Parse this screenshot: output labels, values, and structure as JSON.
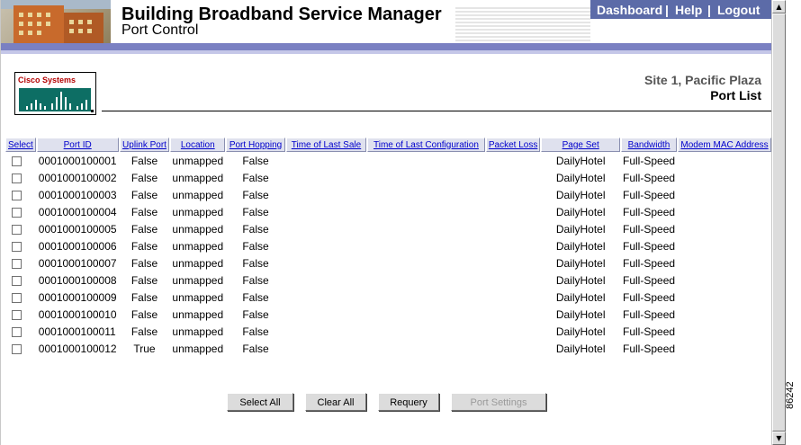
{
  "header": {
    "title": "Building Broadband Service Manager",
    "subtitle": "Port Control",
    "nav": {
      "dashboard": "Dashboard",
      "help": "Help",
      "logout": "Logout",
      "separator": "|"
    }
  },
  "logo": {
    "text": "Cisco Systems"
  },
  "site": {
    "name": "Site 1, Pacific Plaza",
    "page": "Port List"
  },
  "table": {
    "columns": [
      "Select",
      "Port ID",
      "Uplink Port",
      "Location",
      "Port Hopping",
      "Time of Last Sale",
      "Time of Last Configuration",
      "Packet Loss",
      "Page Set",
      "Bandwidth",
      "Modem MAC Address"
    ],
    "rows": [
      {
        "port_id": "0001000100001",
        "uplink": "False",
        "location": "unmapped",
        "hopping": "False",
        "page_set": "DailyHotel",
        "bandwidth": "Full-Speed"
      },
      {
        "port_id": "0001000100002",
        "uplink": "False",
        "location": "unmapped",
        "hopping": "False",
        "page_set": "DailyHotel",
        "bandwidth": "Full-Speed"
      },
      {
        "port_id": "0001000100003",
        "uplink": "False",
        "location": "unmapped",
        "hopping": "False",
        "page_set": "DailyHotel",
        "bandwidth": "Full-Speed"
      },
      {
        "port_id": "0001000100004",
        "uplink": "False",
        "location": "unmapped",
        "hopping": "False",
        "page_set": "DailyHotel",
        "bandwidth": "Full-Speed"
      },
      {
        "port_id": "0001000100005",
        "uplink": "False",
        "location": "unmapped",
        "hopping": "False",
        "page_set": "DailyHotel",
        "bandwidth": "Full-Speed"
      },
      {
        "port_id": "0001000100006",
        "uplink": "False",
        "location": "unmapped",
        "hopping": "False",
        "page_set": "DailyHotel",
        "bandwidth": "Full-Speed"
      },
      {
        "port_id": "0001000100007",
        "uplink": "False",
        "location": "unmapped",
        "hopping": "False",
        "page_set": "DailyHotel",
        "bandwidth": "Full-Speed"
      },
      {
        "port_id": "0001000100008",
        "uplink": "False",
        "location": "unmapped",
        "hopping": "False",
        "page_set": "DailyHotel",
        "bandwidth": "Full-Speed"
      },
      {
        "port_id": "0001000100009",
        "uplink": "False",
        "location": "unmapped",
        "hopping": "False",
        "page_set": "DailyHotel",
        "bandwidth": "Full-Speed"
      },
      {
        "port_id": "0001000100010",
        "uplink": "False",
        "location": "unmapped",
        "hopping": "False",
        "page_set": "DailyHotel",
        "bandwidth": "Full-Speed"
      },
      {
        "port_id": "0001000100011",
        "uplink": "False",
        "location": "unmapped",
        "hopping": "False",
        "page_set": "DailyHotel",
        "bandwidth": "Full-Speed"
      },
      {
        "port_id": "0001000100012",
        "uplink": "True",
        "location": "unmapped",
        "hopping": "False",
        "page_set": "DailyHotel",
        "bandwidth": "Full-Speed"
      }
    ]
  },
  "buttons": {
    "select_all": "Select All",
    "clear_all": "Clear All",
    "requery": "Requery",
    "port_settings": "Port Settings"
  },
  "figure_id": "86242",
  "colors": {
    "nav_bg": "#5c6ba8",
    "band": "#7a80c2",
    "header_link": "#0000cc",
    "logo_red": "#b40000",
    "logo_teal": "#0d6e64"
  }
}
